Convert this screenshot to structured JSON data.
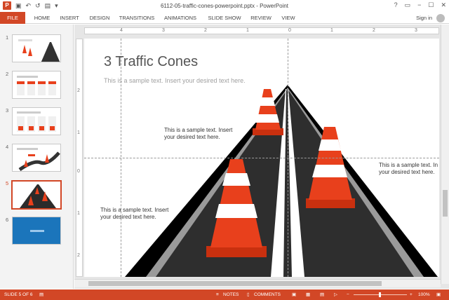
{
  "window": {
    "title": "6112-05-traffic-cones-powerpoint.pptx - PowerPoint",
    "app_icon": "P",
    "controls": [
      "?",
      "▭",
      "−",
      "☐",
      "✕"
    ]
  },
  "quick_access": [
    "save-icon",
    "undo-icon",
    "redo-icon",
    "present-icon",
    "customize-icon"
  ],
  "ribbon": {
    "tabs": [
      "FILE",
      "HOME",
      "INSERT",
      "DESIGN",
      "TRANSITIONS",
      "ANIMATIONS",
      "SLIDE SHOW",
      "REVIEW",
      "VIEW"
    ],
    "sign_in": "Sign in"
  },
  "thumbnails": {
    "numbers": [
      "1",
      "2",
      "3",
      "4",
      "5",
      "6"
    ],
    "active": 5
  },
  "rulers": {
    "top": [
      "4",
      "3",
      "2",
      "1",
      "0",
      "1",
      "2",
      "3"
    ],
    "left": [
      "2",
      "1",
      "0",
      "1",
      "2"
    ]
  },
  "slide": {
    "title": "3 Traffic Cones",
    "subtitle": "This is a sample text. Insert your desired text here.",
    "text_blocks": [
      {
        "line1": "This is a sample text. Insert",
        "line2": "your desired text here."
      },
      {
        "line1": "This is a sample text. In",
        "line2": "your desired text here."
      },
      {
        "line1": "This is a sample text. Insert",
        "line2": "your desired text here."
      }
    ]
  },
  "status": {
    "slide_info": "SLIDE 5 OF 6",
    "notes": "NOTES",
    "comments": "COMMENTS",
    "zoom": "100%"
  },
  "colors": {
    "accent": "#d24726",
    "cone_orange": "#e8401c",
    "road": "#2b2b2b"
  }
}
